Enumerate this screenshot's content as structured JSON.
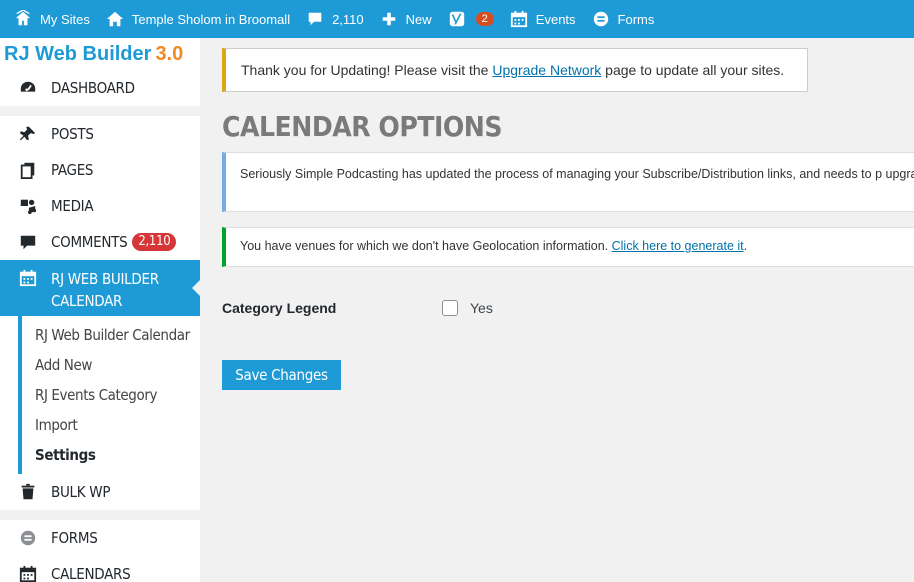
{
  "adminbar": {
    "my_sites": "My Sites",
    "site_name": "Temple Sholom in Broomall",
    "comments_count": "2,110",
    "new_label": "New",
    "yoast_badge": "2",
    "events_label": "Events",
    "forms_label": "Forms"
  },
  "sidebar": {
    "brand_name": "RJ Web Builder",
    "brand_version": "3.0",
    "items": [
      {
        "label": "DASHBOARD",
        "icon": "dashboard-icon"
      },
      {
        "label": "POSTS",
        "icon": "pin-icon"
      },
      {
        "label": "PAGES",
        "icon": "pages-icon"
      },
      {
        "label": "MEDIA",
        "icon": "media-icon"
      },
      {
        "label": "COMMENTS",
        "icon": "comment-icon",
        "badge": "2,110"
      },
      {
        "label_line1": "RJ WEB BUILDER",
        "label_line2": "CALENDAR",
        "icon": "calendar-icon"
      },
      {
        "label": "BULK WP",
        "icon": "trash-icon"
      },
      {
        "label": "FORMS",
        "icon": "forms-icon"
      },
      {
        "label": "CALENDARS",
        "icon": "calendar-icon"
      }
    ],
    "submenu": [
      "RJ Web Builder Calendar",
      "Add New",
      "RJ Events Category",
      "Import",
      "Settings"
    ]
  },
  "notices": {
    "update_pre": "Thank you for Updating! Please visit the ",
    "update_link": "Upgrade Network",
    "update_post": " page to update all your sites.",
    "podcast_text": "Seriously Simple Podcasting has updated the process of managing your Subscribe/Distribution links, and needs to p upgrade.",
    "venues_text": "You have venues for which we don't have Geolocation information. ",
    "venues_link": "Click here to generate it",
    "venues_post": "."
  },
  "page": {
    "title": "CALENDAR OPTIONS",
    "category_legend_label": "Category Legend",
    "checkbox_label": "Yes",
    "checkbox_checked": false,
    "save_button": "Save Changes"
  },
  "colors": {
    "admin_blue": "#1e9ad6",
    "brand_orange": "#f08a24",
    "badge_red": "#d63638"
  }
}
